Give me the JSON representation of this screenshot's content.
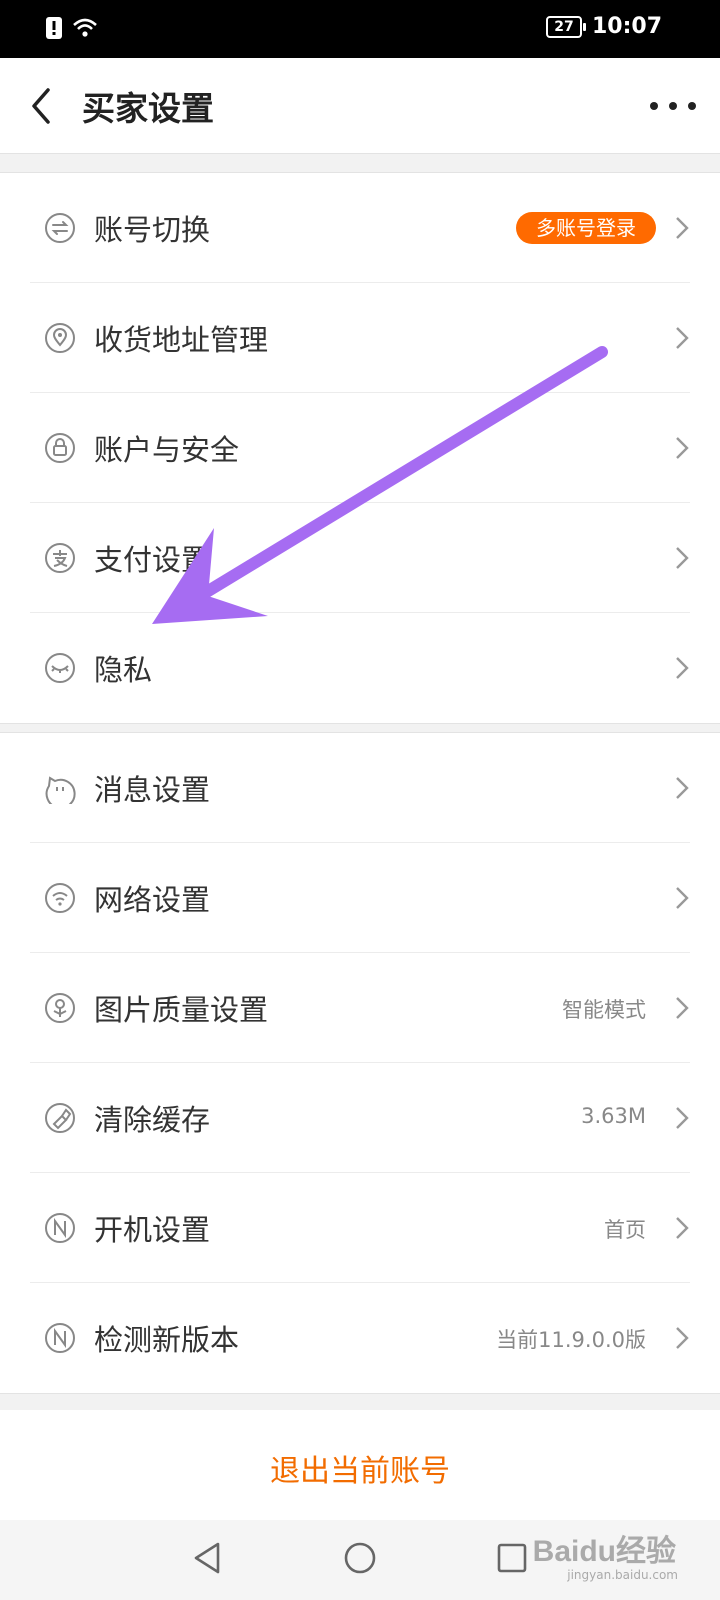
{
  "status_bar": {
    "battery": "27",
    "time": "10:07"
  },
  "header": {
    "title": "买家设置"
  },
  "group1": [
    {
      "label": "账号切换",
      "badge": "多账号登录",
      "icon": "switch-icon"
    },
    {
      "label": "收货地址管理",
      "icon": "location-icon"
    },
    {
      "label": "账户与安全",
      "icon": "lock-icon"
    },
    {
      "label": "支付设置",
      "icon": "pay-icon"
    },
    {
      "label": "隐私",
      "icon": "eye-closed-icon"
    }
  ],
  "group2": [
    {
      "label": "消息设置",
      "icon": "message-icon"
    },
    {
      "label": "网络设置",
      "icon": "wifi-icon"
    },
    {
      "label": "图片质量设置",
      "value": "智能模式",
      "icon": "image-quality-icon"
    },
    {
      "label": "清除缓存",
      "value": "3.63M",
      "icon": "clear-cache-icon"
    },
    {
      "label": "开机设置",
      "value": "首页",
      "icon": "startup-icon"
    },
    {
      "label": "检测新版本",
      "value": "当前11.9.0.0版",
      "icon": "version-icon"
    }
  ],
  "logout": {
    "label": "退出当前账号"
  },
  "watermark": {
    "brand": "Baidu经验",
    "url": "jingyan.baidu.com"
  },
  "colors": {
    "accent": "#ff6a00",
    "logout": "#f26c00",
    "arrow": "#a66cf2"
  }
}
